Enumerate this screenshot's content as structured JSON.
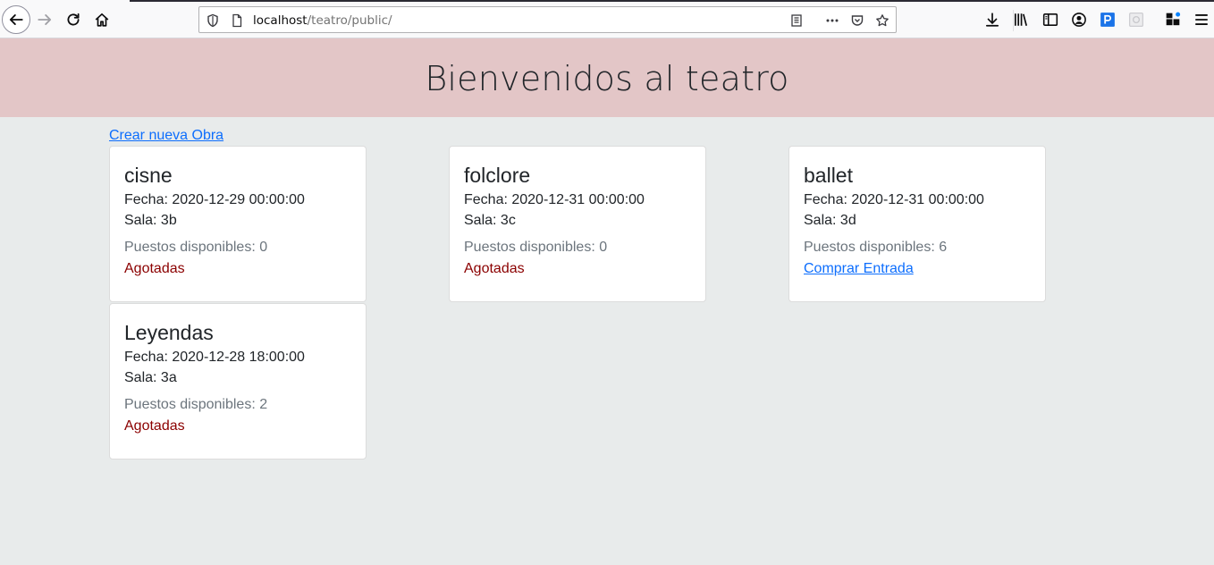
{
  "browser": {
    "url_host": "localhost",
    "url_path": "/teatro/public/"
  },
  "page": {
    "title": "Bienvenidos al teatro",
    "create_link": "Crear nueva Obra"
  },
  "cards": [
    {
      "title": "cisne",
      "fecha": "Fecha: 2020-12-29 00:00:00",
      "sala": "Sala: 3b",
      "puestos": "Puestos disponibles: 0",
      "status": "Agotadas"
    },
    {
      "title": "folclore",
      "fecha": "Fecha: 2020-12-31 00:00:00",
      "sala": "Sala: 3c",
      "puestos": "Puestos disponibles: 0",
      "status": "Agotadas"
    },
    {
      "title": "ballet",
      "fecha": "Fecha: 2020-12-31 00:00:00",
      "sala": "Sala: 3d",
      "puestos": "Puestos disponibles: 6",
      "status": "Comprar Entrada"
    },
    {
      "title": "Leyendas",
      "fecha": "Fecha: 2020-12-28 18:00:00",
      "sala": "Sala: 3a",
      "puestos": "Puestos disponibles: 2",
      "status": "Agotadas"
    }
  ],
  "colors": {
    "header_bg": "#e3c6c7",
    "page_bg": "#e8ebeb",
    "sold_out": "#8b0000",
    "link": "#0d6efd"
  }
}
